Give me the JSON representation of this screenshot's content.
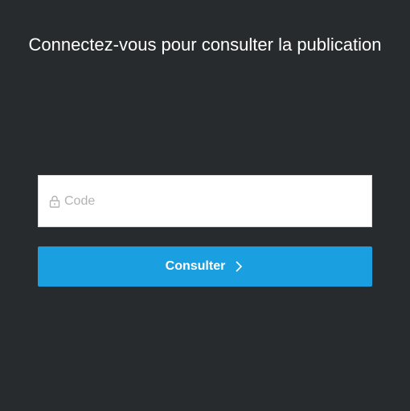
{
  "login": {
    "title": "Connectez-vous pour consulter la publication",
    "code_placeholder": "Code",
    "code_value": "",
    "submit_label": "Consulter"
  },
  "icons": {
    "field_icon": "lock-icon",
    "button_icon": "chevron-right-icon"
  },
  "colors": {
    "background": "#272b2d",
    "button": "#1a9fe0",
    "text": "#ffffff"
  }
}
